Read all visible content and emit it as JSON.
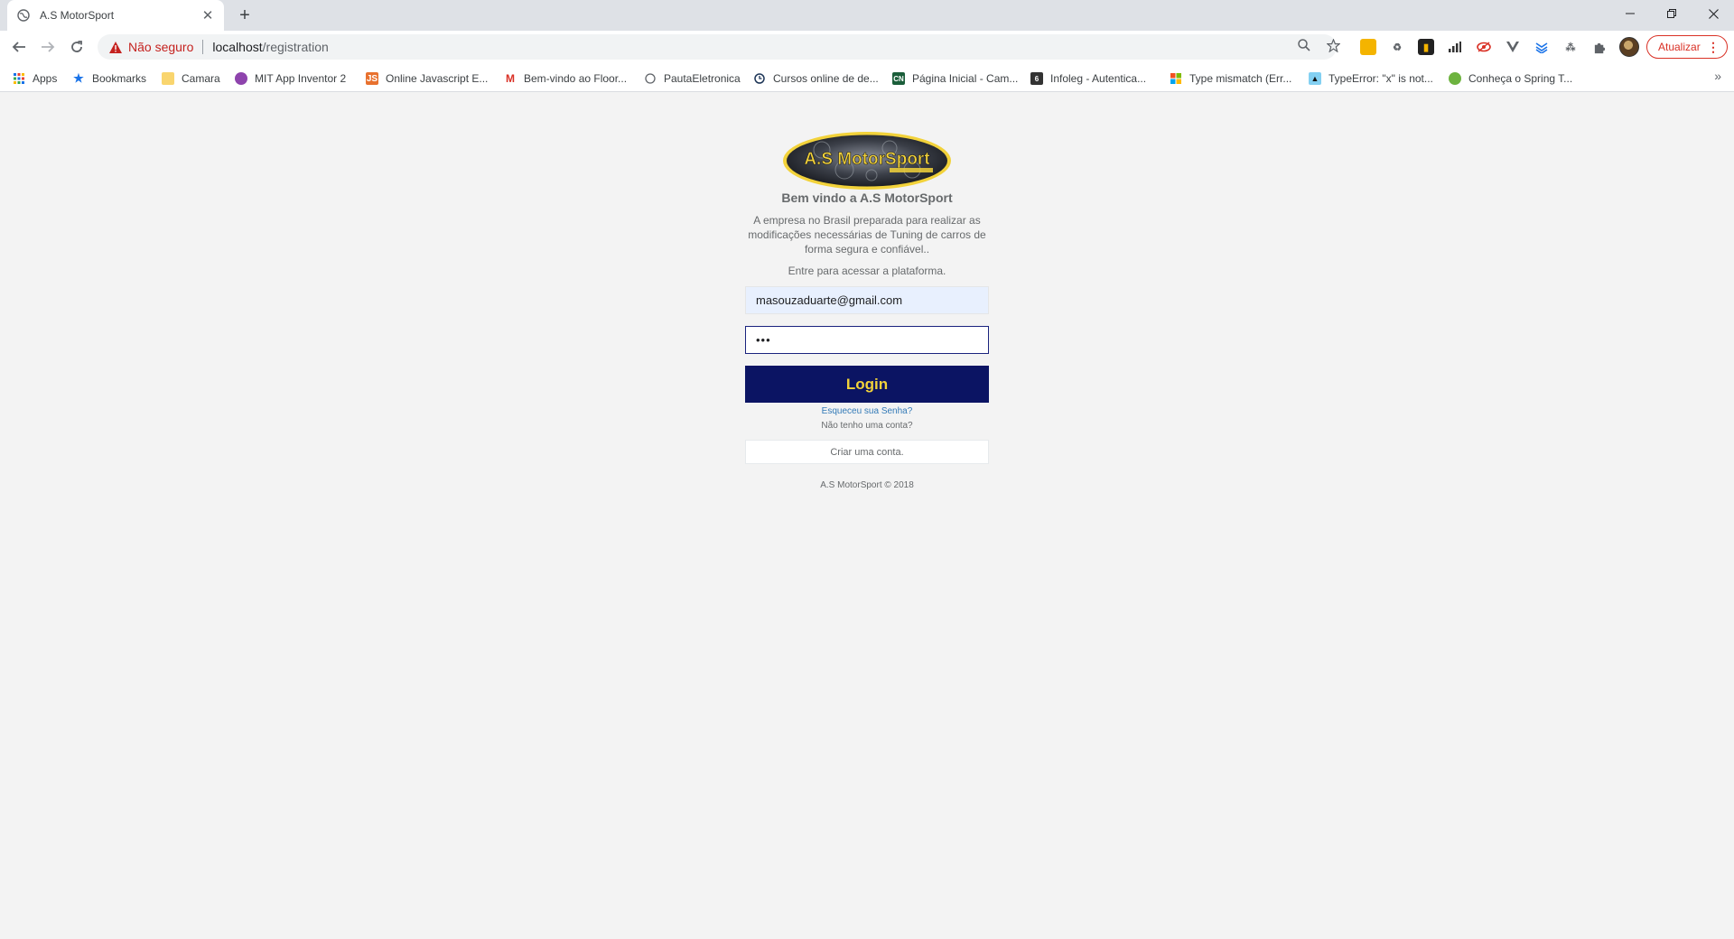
{
  "browser": {
    "tab": {
      "title": "A.S MotorSport"
    },
    "address": {
      "security_label": "Não seguro",
      "host": "localhost",
      "path": "/registration"
    },
    "update_label": "Atualizar",
    "bookmarks": [
      {
        "label": "Apps",
        "icon": "apps-grid-icon"
      },
      {
        "label": "Bookmarks",
        "icon": "star-icon"
      },
      {
        "label": "Camara",
        "icon": "folder-icon"
      },
      {
        "label": "MIT App Inventor 2",
        "icon": "app-inventor-icon"
      },
      {
        "label": "Online Javascript E...",
        "icon": "js-icon"
      },
      {
        "label": "Bem-vindo ao Floor...",
        "icon": "gmail-icon"
      },
      {
        "label": "PautaEletronica",
        "icon": "globe-icon"
      },
      {
        "label": "Cursos online de de...",
        "icon": "clock-icon"
      },
      {
        "label": "Página Inicial - Cam...",
        "icon": "cn-icon"
      },
      {
        "label": "Infoleg - Autentica...",
        "icon": "infoleg-icon"
      },
      {
        "label": "Type mismatch (Err...",
        "icon": "microsoft-icon"
      },
      {
        "label": "TypeError: \"x\" is not...",
        "icon": "mdn-icon"
      },
      {
        "label": "Conheça o Spring T...",
        "icon": "spring-icon"
      }
    ]
  },
  "login": {
    "logo_text": "A.S MotorSport",
    "welcome": "Bem vindo a A.S MotorSport",
    "description": "A empresa no Brasil preparada para realizar as modificações necessárias de Tuning de carros de forma segura e confiável..",
    "prompt": "Entre para acessar a plataforma.",
    "email_value": "masouzaduarte@gmail.com",
    "password_value": "•••",
    "login_label": "Login",
    "forgot_label": "Esqueceu sua Senha?",
    "no_account_label": "Não tenho uma conta?",
    "create_account_label": "Criar uma conta.",
    "copyright": "A.S MotorSport © 2018"
  },
  "colors": {
    "login_button_bg": "#0b1463",
    "login_button_text": "#f2d23a",
    "link": "#337ab7",
    "insecure": "#c5221f"
  }
}
